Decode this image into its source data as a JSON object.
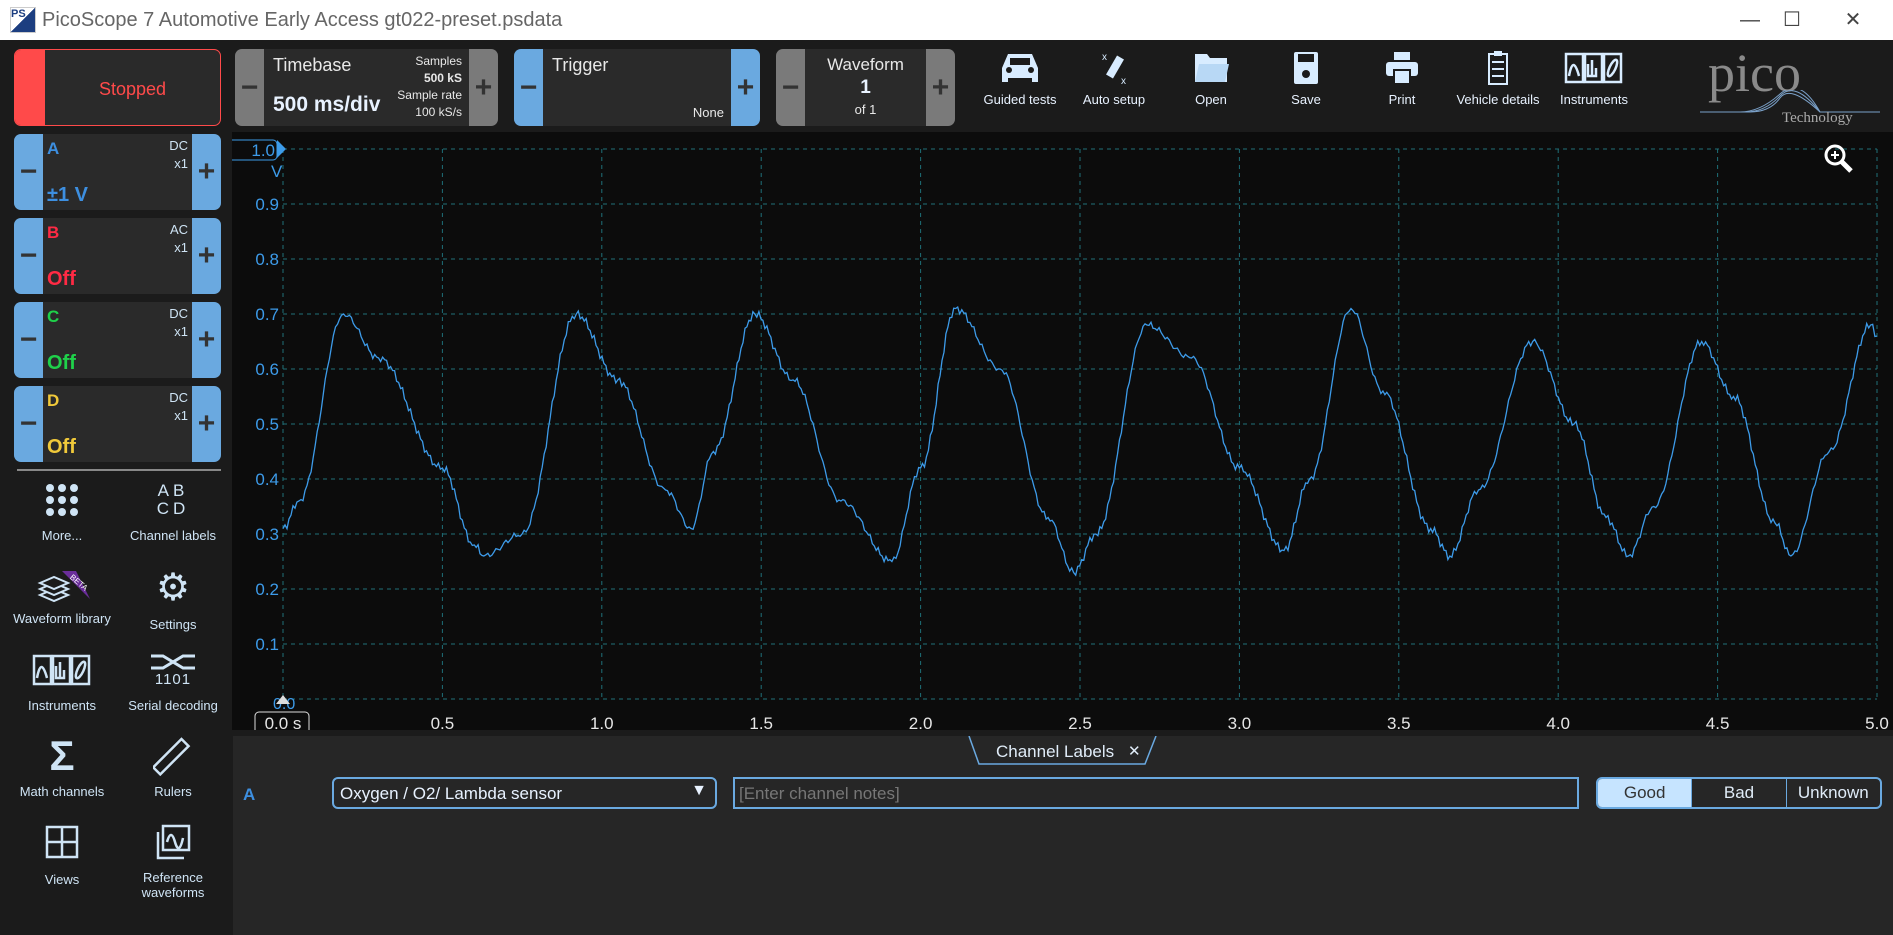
{
  "window": {
    "title": "PicoScope 7 Automotive Early Access gt022-preset.psdata",
    "controls": [
      "minimize",
      "maximize",
      "close"
    ]
  },
  "toolbar": {
    "run_state": "Stopped",
    "timebase": {
      "label": "Timebase",
      "value": "500 ms/div",
      "samples_label": "Samples",
      "samples": "500 kS",
      "rate_label": "Sample rate",
      "rate": "100 kS/s"
    },
    "trigger": {
      "label": "Trigger",
      "mode": "None"
    },
    "waveform": {
      "label": "Waveform",
      "index": "1",
      "of": "of 1"
    },
    "buttons": [
      {
        "label": "Guided tests",
        "icon": "car-icon"
      },
      {
        "label": "Auto setup",
        "icon": "wand-icon"
      },
      {
        "label": "Open",
        "icon": "folder-icon"
      },
      {
        "label": "Save",
        "icon": "floppy-icon"
      },
      {
        "label": "Print",
        "icon": "printer-icon"
      },
      {
        "label": "Vehicle details",
        "icon": "clipboard-icon"
      },
      {
        "label": "Instruments",
        "icon": "instruments-icon"
      }
    ],
    "logo": {
      "text": "pico",
      "sub": "Technology"
    }
  },
  "channels": [
    {
      "name": "A",
      "coupling": "DC",
      "probe": "x1",
      "range": "±1 V",
      "color": "#3d8fe0"
    },
    {
      "name": "B",
      "coupling": "AC",
      "probe": "x1",
      "range": "Off",
      "color": "#ff2a44"
    },
    {
      "name": "C",
      "coupling": "DC",
      "probe": "x1",
      "range": "Off",
      "color": "#1fd14a"
    },
    {
      "name": "D",
      "coupling": "DC",
      "probe": "x1",
      "range": "Off",
      "color": "#f0c93a"
    }
  ],
  "sidebar": [
    {
      "label": "More...",
      "icon": "dots-grid-icon"
    },
    {
      "label": "Channel labels",
      "icon": "abcd-icon"
    },
    {
      "label": "Waveform library",
      "icon": "waveform-library-icon",
      "badge": "BETA"
    },
    {
      "label": "Settings",
      "icon": "gear-icon"
    },
    {
      "label": "Instruments",
      "icon": "instruments-icon"
    },
    {
      "label": "Serial decoding",
      "icon": "serial-decoding-icon",
      "glyph": "1101"
    },
    {
      "label": "Math channels",
      "icon": "sigma-icon"
    },
    {
      "label": "Rulers",
      "icon": "ruler-icon"
    },
    {
      "label": "Views",
      "icon": "views-grid-icon"
    },
    {
      "label": "Reference waveforms",
      "icon": "reference-waveforms-icon"
    }
  ],
  "chart_data": {
    "type": "line",
    "xlabel": "s",
    "ylabel": "V",
    "xlim": [
      0,
      5
    ],
    "ylim": [
      0,
      1
    ],
    "x_ticks": [
      "0.0 s",
      "0.5",
      "1.0",
      "1.5",
      "2.0",
      "2.5",
      "3.0",
      "3.5",
      "4.0",
      "4.5",
      "5.0"
    ],
    "y_ticks": [
      "0.0",
      "0.1",
      "0.2",
      "0.3",
      "0.4",
      "0.5",
      "0.6",
      "0.7",
      "0.8",
      "0.9",
      "1.0"
    ],
    "grid": true,
    "series": [
      {
        "channel": "A",
        "color": "#3d9be9",
        "x": [
          0,
          0.05,
          0.19,
          0.3,
          0.5,
          0.6,
          0.63,
          0.75,
          0.92,
          1.05,
          1.2,
          1.28,
          1.35,
          1.48,
          1.6,
          1.75,
          1.91,
          2.0,
          2.11,
          2.25,
          2.4,
          2.48,
          2.55,
          2.71,
          2.85,
          3.0,
          3.14,
          3.22,
          3.35,
          3.45,
          3.6,
          3.66,
          3.75,
          3.92,
          4.05,
          4.15,
          4.22,
          4.3,
          4.45,
          4.55,
          4.68,
          4.73,
          4.85,
          4.98,
          5.0
        ],
        "y": [
          0.31,
          0.36,
          0.7,
          0.62,
          0.42,
          0.28,
          0.26,
          0.3,
          0.7,
          0.58,
          0.38,
          0.31,
          0.45,
          0.7,
          0.58,
          0.36,
          0.25,
          0.42,
          0.71,
          0.6,
          0.33,
          0.23,
          0.3,
          0.68,
          0.62,
          0.42,
          0.27,
          0.4,
          0.71,
          0.56,
          0.31,
          0.26,
          0.38,
          0.65,
          0.5,
          0.33,
          0.26,
          0.35,
          0.65,
          0.55,
          0.32,
          0.26,
          0.45,
          0.68,
          0.66
        ]
      }
    ]
  },
  "bottom_panel": {
    "tab": "Channel Labels",
    "channel": "A",
    "label_select": "Oxygen / O2/ Lambda sensor",
    "notes_placeholder": "[Enter channel notes]",
    "rating": {
      "options": [
        "Good",
        "Bad",
        "Unknown"
      ],
      "selected": "Good"
    }
  }
}
